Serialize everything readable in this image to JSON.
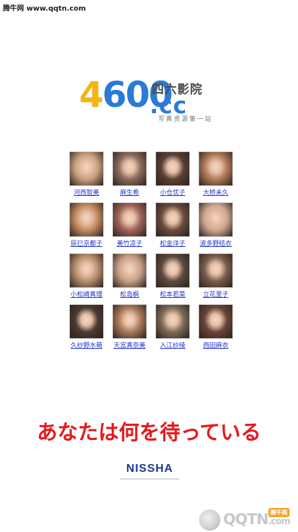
{
  "watermark_top": "腾牛网 www.qqtn.com",
  "logo": {
    "digit_four": "4",
    "digits_rest": "600",
    "chinese_name": "四六影院",
    "domain_suffix": ".cc",
    "tagline": "写真资源第一站"
  },
  "actresses": [
    {
      "name": "河西智美",
      "tone": "#c9a27f"
    },
    {
      "name": "麻生希",
      "tone": "#8a6a5a"
    },
    {
      "name": "小仓优子",
      "tone": "#5a4035"
    },
    {
      "name": "大桥未久",
      "tone": "#b07a5a"
    },
    {
      "name": "辰巳京都子",
      "tone": "#c48b62"
    },
    {
      "name": "美竹凉子",
      "tone": "#a0645a"
    },
    {
      "name": "松金洋子",
      "tone": "#6a4c3e"
    },
    {
      "name": "波多野结衣",
      "tone": "#d0a890"
    },
    {
      "name": "小松崎真理",
      "tone": "#b89070"
    },
    {
      "name": "松岛枫",
      "tone": "#c8a088"
    },
    {
      "name": "松本若菜",
      "tone": "#5c4a40"
    },
    {
      "name": "立花里子",
      "tone": "#7a5c4c"
    },
    {
      "name": "久纱野水萌",
      "tone": "#4a3a30"
    },
    {
      "name": "天宫真奈美",
      "tone": "#a87858"
    },
    {
      "name": "入江纱绫",
      "tone": "#7a6a58"
    },
    {
      "name": "西田麻衣",
      "tone": "#6a4438"
    }
  ],
  "slogan": "あなたは何を待っている",
  "brand": "NISSHA",
  "watermark_bottom": {
    "main": "QQTN",
    "suffix": ".com",
    "badge": "腾牛网"
  },
  "colors": {
    "link": "#2233cc",
    "slogan_red": "#e6191c",
    "logo_yellow": "#f3b416",
    "logo_blue": "#2a7ad8"
  }
}
